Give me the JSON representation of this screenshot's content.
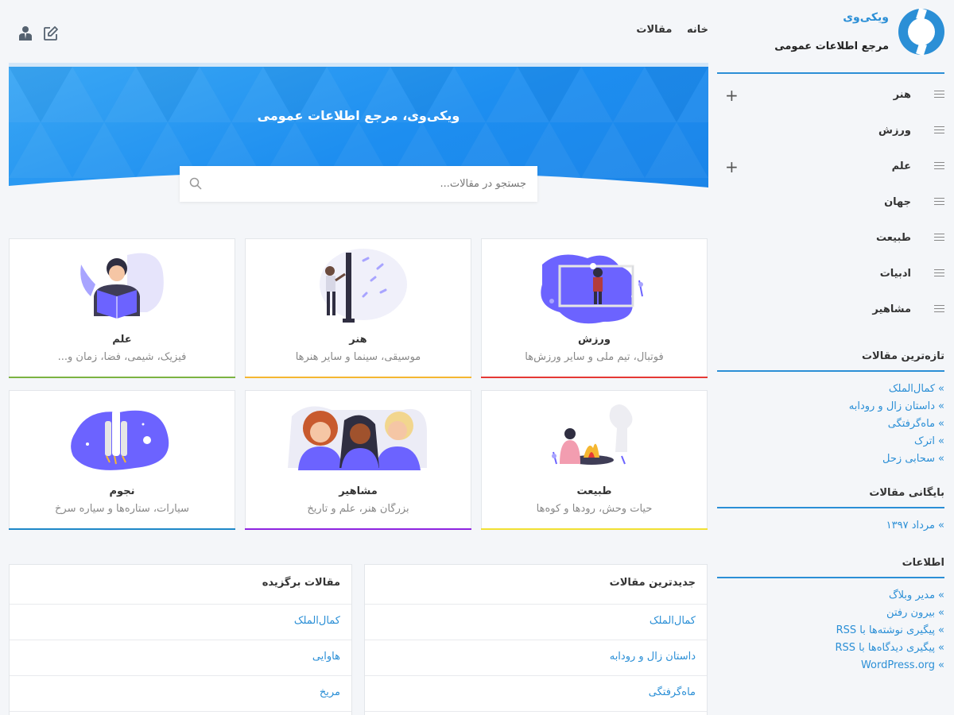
{
  "site": {
    "title": "ویکی‌وی",
    "description": "مرجع اطلاعات عمومی"
  },
  "topnav": {
    "items": [
      "خانه",
      "مقالات"
    ]
  },
  "header_icons": [
    "user-icon",
    "edit-icon"
  ],
  "hero": {
    "title": "ویکی‌وی، مرجع اطلاعات عمومی",
    "search_placeholder": "جستجو در مقالات..."
  },
  "sidebar": {
    "categories": [
      {
        "label": "هنر",
        "expandable": true
      },
      {
        "label": "ورزش",
        "expandable": false
      },
      {
        "label": "علم",
        "expandable": true
      },
      {
        "label": "جهان",
        "expandable": false
      },
      {
        "label": "طبیعت",
        "expandable": false
      },
      {
        "label": "ادبیات",
        "expandable": false
      },
      {
        "label": "مشاهیر",
        "expandable": false
      }
    ],
    "recent": {
      "title": "تازه‌ترین مقالات",
      "items": [
        "کمال‌الملک",
        "داستان زال و رودابه",
        "ماه‌گرفتگی",
        "اترک",
        "سحابی زحل"
      ]
    },
    "archive": {
      "title": "بایگانی مقالات",
      "items": [
        "مرداد ۱۳۹۷"
      ]
    },
    "info": {
      "title": "اطلاعات",
      "items": [
        "مدیر وبلاگ",
        "بیرون رفتن",
        "پیگیری نوشته‌ها با RSS",
        "پیگیری دیدگاه‌ها با RSS",
        "WordPress.org"
      ]
    },
    "arrow": "»"
  },
  "cards": [
    {
      "title": "ورزش",
      "desc": "فوتبال، تیم ملی و سایر ورزش‌ها",
      "color": "#e53935"
    },
    {
      "title": "هنر",
      "desc": "موسیقی، سینما و سایر هنرها",
      "color": "#f5b731"
    },
    {
      "title": "علم",
      "desc": "فیزیک، شیمی، فضا، زمان و...",
      "color": "#7cb342"
    },
    {
      "title": "طبیعت",
      "desc": "حیات وحش، رودها و کوه‌ها",
      "color": "#f1e033"
    },
    {
      "title": "مشاهیر",
      "desc": "بزرگان هنر، علم و تاریخ",
      "color": "#8e24e0"
    },
    {
      "title": "نجوم",
      "desc": "سیارات، ستاره‌ها و سیاره سرخ",
      "color": "#1e88c8"
    }
  ],
  "newest": {
    "title": "جدیدترین مقالات",
    "items": [
      "کمال‌الملک",
      "داستان زال و رودابه",
      "ماه‌گرفتگی"
    ]
  },
  "featured": {
    "title": "مقالات برگزیده",
    "items": [
      "کمال‌الملک",
      "هاوایی",
      "مریخ"
    ]
  },
  "colors": {
    "accent": "#2b8fd6",
    "hero": "#1d8ef0",
    "illustration": "#6c63ff"
  }
}
